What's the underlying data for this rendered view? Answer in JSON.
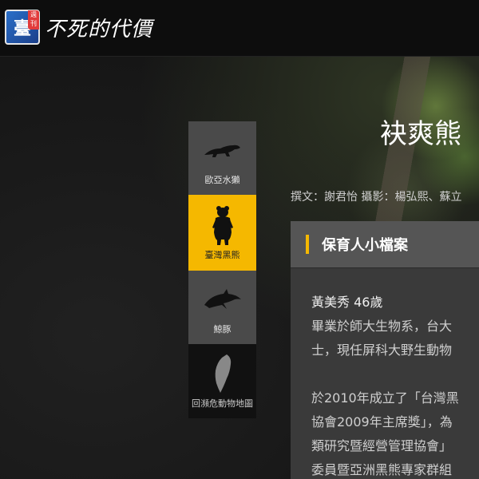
{
  "header": {
    "logo_char": "臺",
    "logo_sub": "週刊",
    "site_title": "不死的代價"
  },
  "sidenav": {
    "items": [
      {
        "label": "歐亞水獺",
        "icon": "otter-icon",
        "active": false
      },
      {
        "label": "臺灣黑熊",
        "icon": "bear-icon",
        "active": true
      },
      {
        "label": "鯨豚",
        "icon": "dolphin-icon",
        "active": false
      },
      {
        "label": "回瀕危動物地圖",
        "icon": "taiwan-map-icon",
        "active": false
      }
    ]
  },
  "article": {
    "title": "袂爽熊",
    "byline": "撰文：謝君怡 攝影：楊弘熙、蘇立"
  },
  "profile": {
    "header": "保育人小檔案",
    "name_line": "黃美秀 46歲",
    "lines": [
      "畢業於師大生物系，台大",
      "士，現任屏科大野生動物"
    ],
    "lines2": [
      "於2010年成立了「台灣黑",
      "協會2009年主席獎」，為",
      "類研究暨經營管理協會」",
      "委員暨亞洲黑熊專家群組"
    ]
  },
  "colors": {
    "accent": "#f5b800",
    "nav_bg": "#4a4a4a"
  }
}
